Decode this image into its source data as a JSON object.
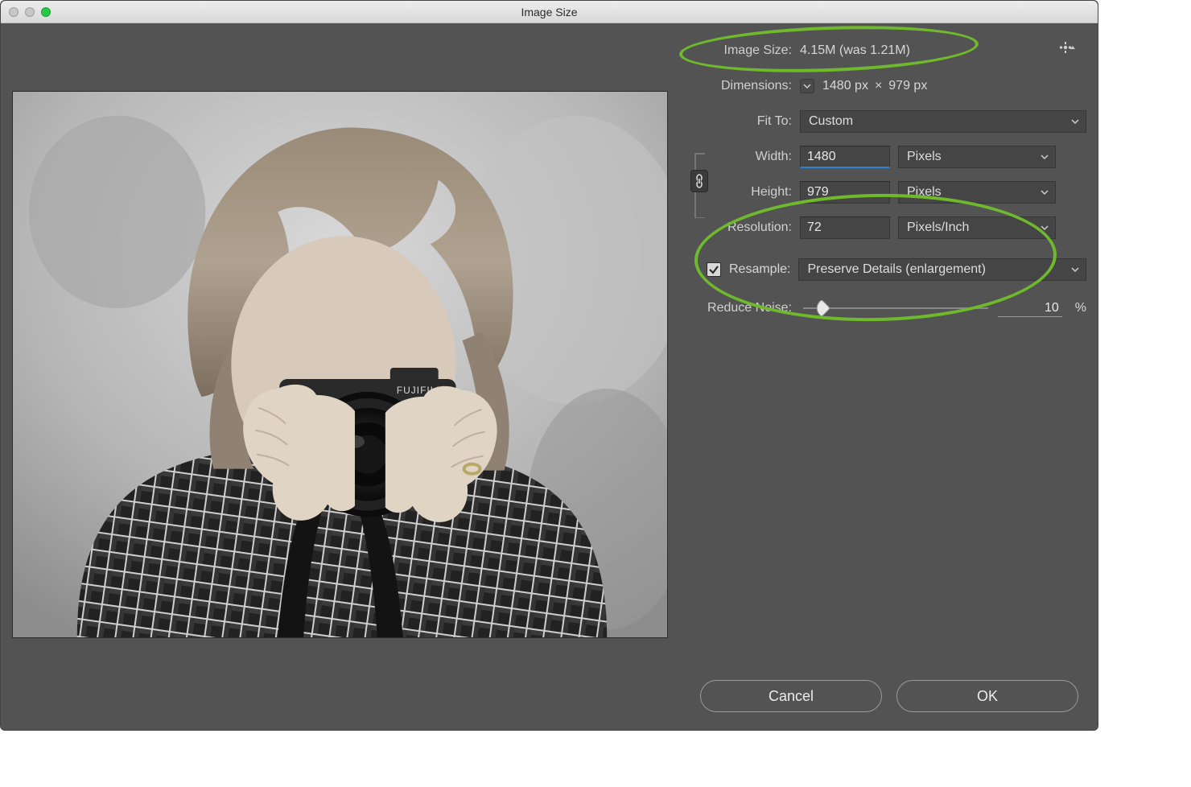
{
  "window": {
    "title": "Image Size"
  },
  "gearIcon": "gear",
  "panel": {
    "imageSizeLabel": "Image Size:",
    "imageSizeValue": "4.15M (was 1.21M)",
    "dimensionsLabel": "Dimensions:",
    "dimWidth": "1480 px",
    "dimTimes": "×",
    "dimHeight": "979 px",
    "fitToLabel": "Fit To:",
    "fitToValue": "Custom",
    "widthLabel": "Width:",
    "widthValue": "1480",
    "widthUnit": "Pixels",
    "heightLabel": "Height:",
    "heightValue": "979",
    "heightUnit": "Pixels",
    "resolutionLabel": "Resolution:",
    "resolutionValue": "72",
    "resolutionUnit": "Pixels/Inch",
    "resampleLabel": "Resample:",
    "resampleValue": "Preserve Details (enlargement)",
    "resampleChecked": true,
    "reduceNoiseLabel": "Reduce Noise:",
    "reduceNoiseValue": "10",
    "reduceNoisePercent": "%",
    "reduceNoiseSliderPos": 10
  },
  "footer": {
    "cancel": "Cancel",
    "ok": "OK"
  }
}
